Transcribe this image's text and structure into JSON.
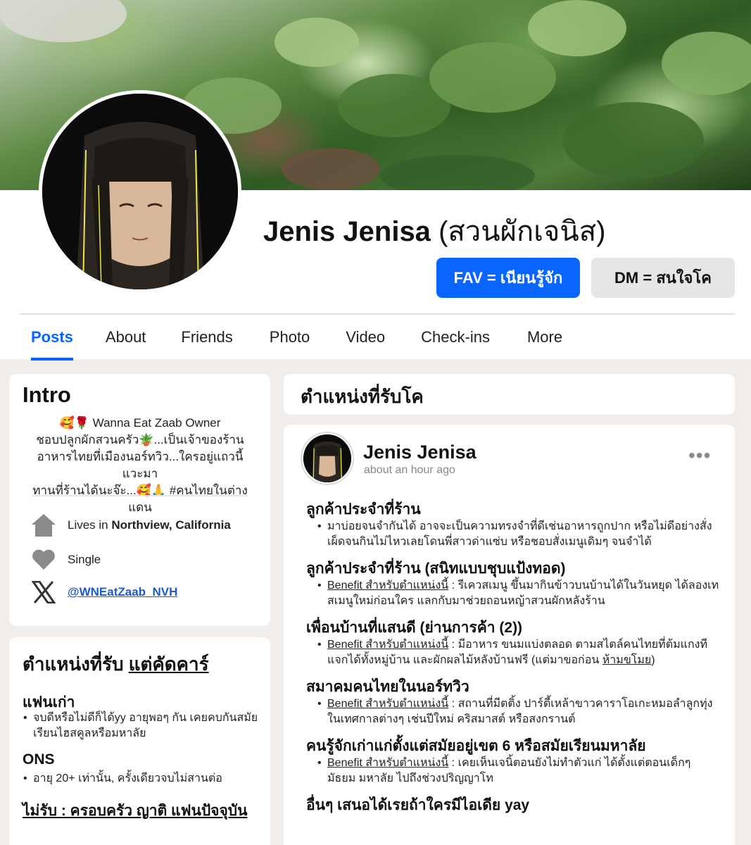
{
  "profile": {
    "name_bold": "Jenis Jenisa",
    "name_suffix": "(สวนผักเจนิส)",
    "fav_button": "FAV = เนียนรู้จัก",
    "dm_button": "DM = สนใจโค"
  },
  "tabs": [
    {
      "label": "Posts",
      "active": true
    },
    {
      "label": "About"
    },
    {
      "label": "Friends"
    },
    {
      "label": "Photo"
    },
    {
      "label": "Video"
    },
    {
      "label": "Check-ins"
    },
    {
      "label": "More"
    }
  ],
  "intro": {
    "title": "Intro",
    "bio_lines": [
      "🥰🌹 Wanna Eat Zaab Owner",
      "ชอบปลูกผักสวนครัว🪴...เป็นเจ้าของร้าน",
      "อาหารไทยที่เมืองนอร์ทวิว...ใครอยู่แถวนี้แวะมา",
      "ทานที่ร้านได้นะจ๊ะ...🥰🙏 #คนไทยในต่างแดน"
    ],
    "lives_prefix": "Lives in",
    "lives_place": "Northview, California",
    "relationship": "Single",
    "x_handle": "@WNEatZaab_NVH",
    "icons": {
      "home": "home-icon",
      "heart": "heart-icon",
      "x": "x-logo-icon"
    }
  },
  "rules": {
    "title_prefix": "ตำแหน่งที่รับ",
    "title_underlined": "แต่คัดคาร์",
    "ex_title": "แฟนเก่า",
    "ex_text": "จบดีหรือไม่ดีก็ได้yy อายุพอๆ กัน เคยคบกันสมัยเรียนไฮสคูลหรือมหาลัย",
    "ons_title": "ONS",
    "ons_text": "อายุ 20+ เท่านั้น, ครั้งเดียวจบไม่สานต่อ",
    "reject": "ไม่รับ : ครอบครัว ญาติ แฟนปัจจุบัน"
  },
  "positions": {
    "title": "ตำแหน่งที่รับโค"
  },
  "post": {
    "author": "Jenis Jenisa",
    "time": "about an hour ago",
    "more": "•••",
    "benefit_label": "Benefit สำหรับตำแหน่งนี้",
    "sections": [
      {
        "title": "ลูกค้าประจำที่ร้าน",
        "text": "มาบ่อยจนจำกันได้ อาจจะเป็นความทรงจำที่ดีเช่นอาหารถูกปาก หรือไม่ดีอย่างสั่งเผ็ดจนกินไม่ไหวเลยโดนพี่สาวด่าแซ่บ หรือชอบสั่งเมนูเดิมๆ จนจำได้"
      },
      {
        "title": "ลูกค้าประจำที่ร้าน (สนิทแบบชุบแป้งทอด)",
        "text": " : รีเควสเมนู ขึ้นมากินข้าวบนบ้านได้ในวันหยุด ได้ลองเทสเมนูใหม่ก่อนใคร แลกกับมาช่วยถอนหญ้าสวนผักหลังร้าน"
      },
      {
        "title": "เพื่อนบ้านที่แสนดี (ย่านการค้า (2))",
        "text": " : มีอาหาร ขนมแบ่งตลอด ตามสไตล์คนไทยที่ต้มแกงทีแจกได้ทั้งหมู่บ้าน และผักผลไม้หลังบ้านฟรี (แต่มาขอก่อน ",
        "tail_underlined": "ห้ามขโมย",
        "tail_end": ")"
      },
      {
        "title": "สมาคมคนไทยในนอร์ทวิว",
        "text": " : สถานที่มีตติ้ง ปาร์ตี้เหล้าขาวคาราโอเกะหมอลำลูกทุ่งในเทศกาลต่างๆ เช่นปีใหม่ คริสมาสต์ หรือสงกรานต์"
      },
      {
        "title": "คนรู้จักเก่าแก่ตั้งแต่สมัยอยู่เขต 6 หรือสมัยเรียนมหาลัย",
        "text": " : เคยเห็นเจนิ้ตอนยังไม่ทำตัวแก่ ได้ตั้งแต่ตอนเด็กๆ มัธยม มหาลัย ไปถึงช่วงปริญญาโท"
      },
      {
        "title": "อื่นๆ เสนอได้เรยถ้าใครมีไอเดีย yay"
      }
    ]
  },
  "colors": {
    "accent": "#0866ff",
    "background": "#f0edeb",
    "card": "#ffffff",
    "dm_button": "#e6e6e6"
  }
}
